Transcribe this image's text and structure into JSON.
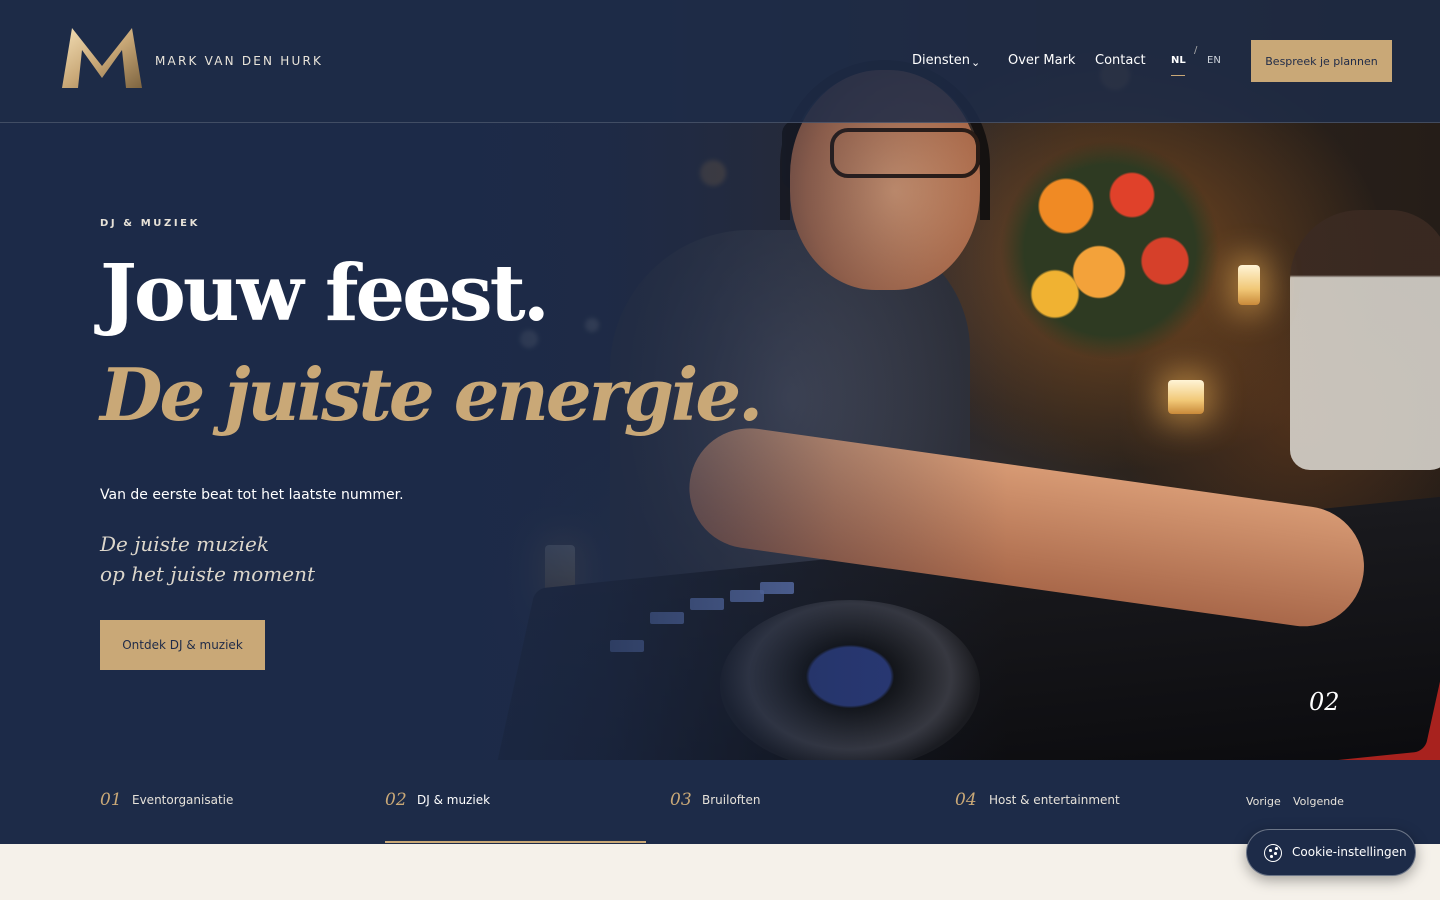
{
  "header": {
    "brand": "MARK VAN DEN HURK",
    "nav": {
      "diensten": "Diensten",
      "over": "Over Mark",
      "contact": "Contact"
    },
    "lang": {
      "nl": "NL",
      "separator": "/",
      "en": "EN"
    },
    "cta": "Bespreek je plannen"
  },
  "hero": {
    "eyebrow": "DJ & MUZIEK",
    "title_line1": "Jouw feest.",
    "title_line2": "De juiste energie.",
    "lead": "Van de eerste beat tot het laatste nummer.",
    "tagline_1": "De juiste muziek",
    "tagline_2": "op het juiste moment",
    "cta": "Ontdek DJ & muziek",
    "slide_number": "02"
  },
  "slider": {
    "tabs": [
      {
        "num": "01",
        "label": "Eventorganisatie"
      },
      {
        "num": "02",
        "label": "DJ & muziek"
      },
      {
        "num": "03",
        "label": "Bruiloften"
      },
      {
        "num": "04",
        "label": "Host & entertainment"
      }
    ],
    "prev": "Vorige",
    "next": "Volgende"
  },
  "cookie": {
    "label": "Cookie-instellingen"
  },
  "colors": {
    "navy": "#1d2b48",
    "gold": "#c9a877",
    "cream": "#f5f1ea"
  }
}
